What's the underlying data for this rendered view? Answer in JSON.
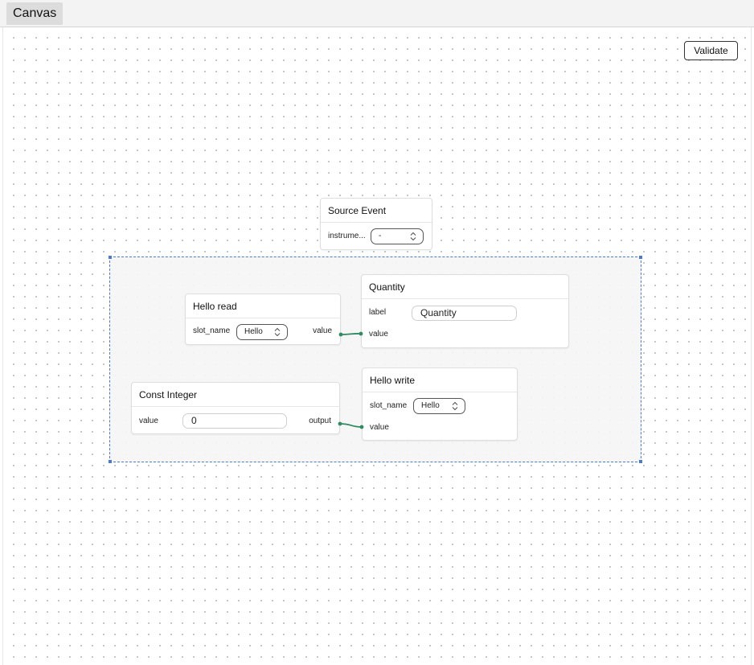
{
  "tab": {
    "label": "Canvas"
  },
  "toolbar": {
    "validate_label": "Validate"
  },
  "nodes": {
    "source_event": {
      "title": "Source Event",
      "field_label": "instrume...",
      "select_value": "-"
    },
    "hello_read": {
      "title": "Hello read",
      "field_label": "slot_name",
      "select_value": "Hello",
      "output_label": "value"
    },
    "quantity": {
      "title": "Quantity",
      "label_field": "label",
      "label_value": "Quantity",
      "input_label": "value"
    },
    "const_integer": {
      "title": "Const Integer",
      "value_label": "value",
      "value": "0",
      "output_label": "output"
    },
    "hello_write": {
      "title": "Hello write",
      "field_label": "slot_name",
      "select_value": "Hello",
      "input_label": "value"
    }
  },
  "colors": {
    "edge": "#2e8b62",
    "group_border": "#4a7bd0"
  }
}
